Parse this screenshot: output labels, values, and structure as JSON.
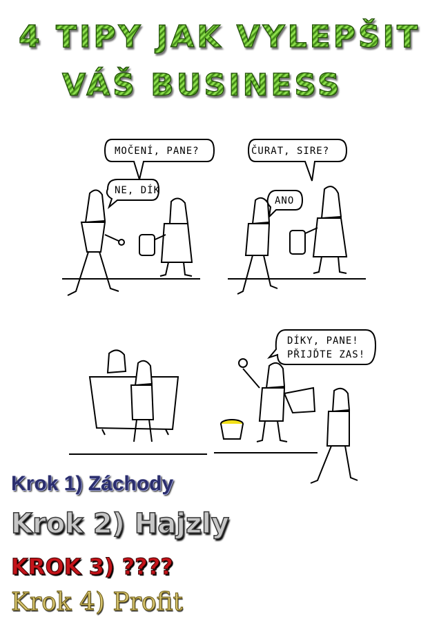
{
  "title": {
    "line1": "4 tipy jak vylepšit",
    "line2": "váš business"
  },
  "comic": {
    "panel1": {
      "speech_vendor": "MOČENÍ, PANE?",
      "speech_customer": "NE, DÍK"
    },
    "panel2": {
      "speech_vendor": "ČURAT, SIRE?",
      "speech_customer": "ANO"
    },
    "panel4": {
      "speech_vendor_line1": "DÍKY, PANE!",
      "speech_vendor_line2": "PŘIJĎTE ZAS!"
    }
  },
  "steps": [
    "Krok 1) Záchody",
    "Krok 2) Hajzly",
    "KROK 3) ????",
    "Krok 4) Profit"
  ],
  "colors": {
    "title_green": "#7fd43a",
    "step1": "#2b2e6e",
    "step2": "#c7c7c7",
    "step3": "#c4141a",
    "step4": "#d6c470",
    "bucket_yellow": "#f2e11a"
  }
}
